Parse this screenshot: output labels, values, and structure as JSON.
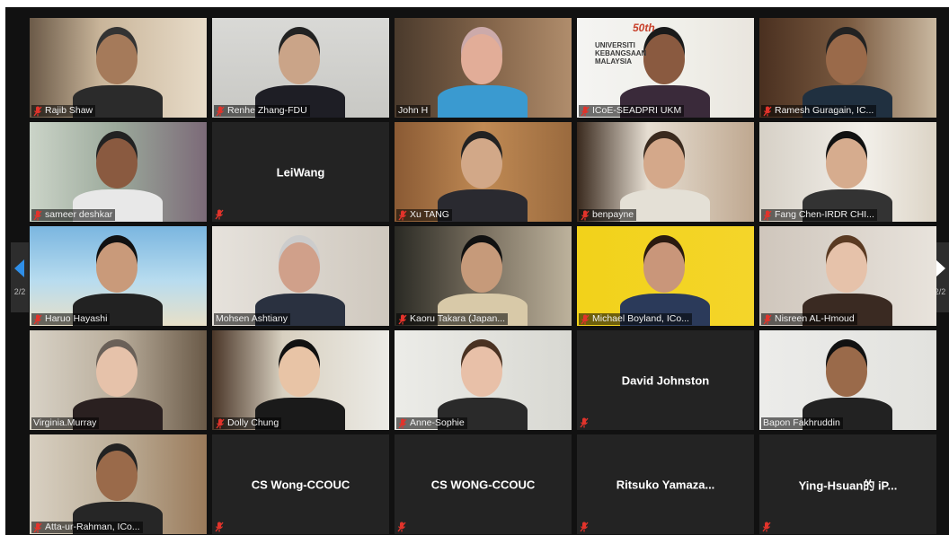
{
  "pager": {
    "left_count": "2/2",
    "right_count": "2/2"
  },
  "colors": {
    "muted_mic": "#e2332b",
    "tile_bg": "#232323",
    "nav_left_arrow": "#2f8fe8",
    "nav_right_arrow": "#ffffff"
  },
  "participants": [
    {
      "name": "Rajib Shaw",
      "video": true,
      "muted": true
    },
    {
      "name": "Renhe Zhang-FDU",
      "video": true,
      "muted": true
    },
    {
      "name": "John H",
      "video": true,
      "muted": false
    },
    {
      "name": "ICoE-SEADPRI UKM",
      "video": true,
      "muted": true,
      "bg_text": [
        "UNIVERSITI",
        "KEBANGSAAN",
        "MALAYSIA"
      ],
      "bg_badge": "50th"
    },
    {
      "name": "Ramesh Guragain, IC...",
      "video": true,
      "muted": true
    },
    {
      "name": "sameer deshkar",
      "video": true,
      "muted": true
    },
    {
      "name": "LeiWang",
      "video": false,
      "muted": true
    },
    {
      "name": "Xu TANG",
      "video": true,
      "muted": true
    },
    {
      "name": "benpayne",
      "video": true,
      "muted": true
    },
    {
      "name": "Fang Chen-IRDR CHI...",
      "video": true,
      "muted": true
    },
    {
      "name": "Haruo Hayashi",
      "video": true,
      "muted": true
    },
    {
      "name": "Mohsen Ashtiany",
      "video": true,
      "muted": false
    },
    {
      "name": "Kaoru Takara (Japan...",
      "video": true,
      "muted": true
    },
    {
      "name": "Michael Boyland, ICo...",
      "video": true,
      "muted": true
    },
    {
      "name": "Nisreen AL-Hmoud",
      "video": true,
      "muted": true
    },
    {
      "name": "Virginia.Murray",
      "video": true,
      "muted": false
    },
    {
      "name": "Dolly Chung",
      "video": true,
      "muted": true
    },
    {
      "name": "Anne-Sophie",
      "video": true,
      "muted": true
    },
    {
      "name": "David Johnston",
      "video": false,
      "muted": true
    },
    {
      "name": "Bapon Fakhruddin",
      "video": true,
      "muted": false
    },
    {
      "name": "Atta-ur-Rahman, ICo...",
      "video": true,
      "muted": true
    },
    {
      "name": "CS Wong-CCOUC",
      "video": false,
      "muted": true
    },
    {
      "name": "CS WONG-CCOUC",
      "video": false,
      "muted": true
    },
    {
      "name": "Ritsuko  Yamaza...",
      "video": false,
      "muted": true
    },
    {
      "name": "Ying-Hsuan的 iP...",
      "video": false,
      "muted": true
    }
  ]
}
